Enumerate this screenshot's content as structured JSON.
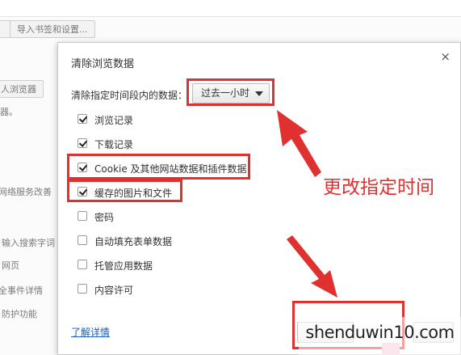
{
  "background": {
    "import_button": "导入书签和设置...",
    "browser_button": "人浏览器",
    "fragments": [
      "器。",
      "网络服务改善",
      "输入搜索字词",
      "网页",
      "全事件详情",
      "防护功能"
    ]
  },
  "dialog": {
    "title": "清除浏览数据",
    "close_glyph": "×",
    "range_label": "清除指定时间段内的数据：",
    "range_value": "过去一小时",
    "options": [
      {
        "label": "浏览记录",
        "checked": true
      },
      {
        "label": "下载记录",
        "checked": true
      },
      {
        "label": "Cookie 及其他网站数据和插件数据",
        "checked": true
      },
      {
        "label": "缓存的图片和文件",
        "checked": true
      },
      {
        "label": "密码",
        "checked": false
      },
      {
        "label": "自动填充表单数据",
        "checked": false
      },
      {
        "label": "托管应用数据",
        "checked": false
      },
      {
        "label": "内容许可",
        "checked": false
      }
    ],
    "learn_more": "了解详情"
  },
  "annotation": {
    "text": "更改指定时间",
    "color": "#e03131"
  },
  "watermark": "shenduwin10.com"
}
